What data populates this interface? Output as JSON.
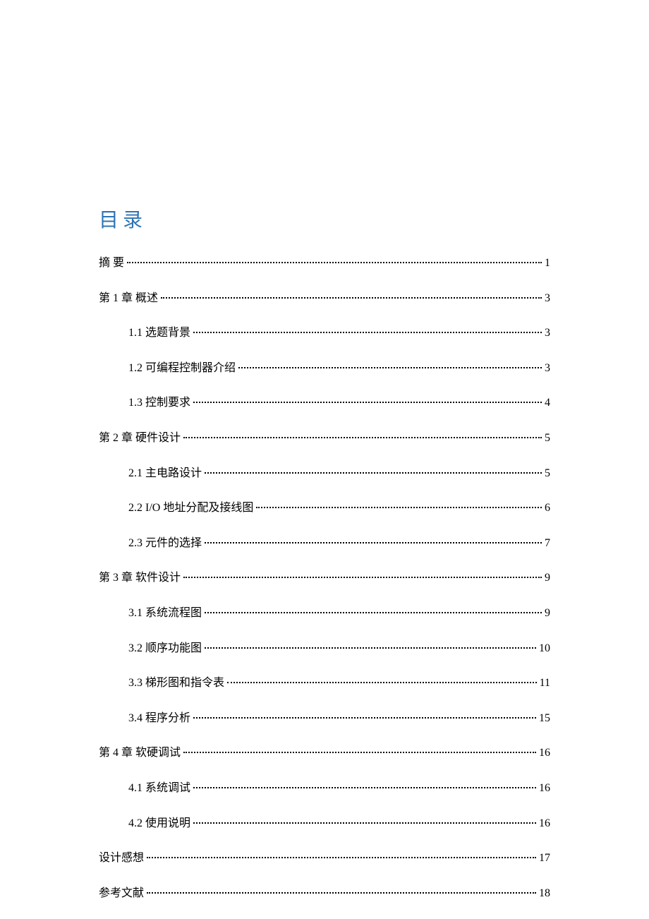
{
  "toc_title": "目录",
  "entries": [
    {
      "level": 1,
      "label": "摘 要",
      "page": "1"
    },
    {
      "level": 1,
      "label": "第 1 章   概述",
      "page": "3"
    },
    {
      "level": 2,
      "label": "1.1 选题背景",
      "page": "3"
    },
    {
      "level": 2,
      "label": "1.2 可编程控制器介绍",
      "page": "3"
    },
    {
      "level": 2,
      "label": "1.3 控制要求",
      "page": "4"
    },
    {
      "level": 1,
      "label": "第 2 章  硬件设计",
      "page": "5"
    },
    {
      "level": 2,
      "label": "2.1  主电路设计",
      "page": "5"
    },
    {
      "level": 2,
      "label": "2.2    I/O 地址分配及接线图",
      "page": "6"
    },
    {
      "level": 2,
      "label": "2.3  元件的选择",
      "page": "7"
    },
    {
      "level": 1,
      "label": "第 3 章  软件设计",
      "page": "9"
    },
    {
      "level": 2,
      "label": "3.1 系统流程图",
      "page": "9"
    },
    {
      "level": 2,
      "label": "3.2 顺序功能图",
      "page": "10"
    },
    {
      "level": 2,
      "label": "3.3 梯形图和指令表",
      "page": "11"
    },
    {
      "level": 2,
      "label": "3.4 程序分析",
      "page": "15"
    },
    {
      "level": 1,
      "label": "第 4 章  软硬调试",
      "page": "16"
    },
    {
      "level": 2,
      "label": "4.1 系统调试",
      "page": "16"
    },
    {
      "level": 2,
      "label": "4.2  使用说明",
      "page": "16"
    },
    {
      "level": 1,
      "label": "设计感想",
      "page": "17"
    },
    {
      "level": 1,
      "label": "参考文献",
      "page": "18"
    }
  ]
}
